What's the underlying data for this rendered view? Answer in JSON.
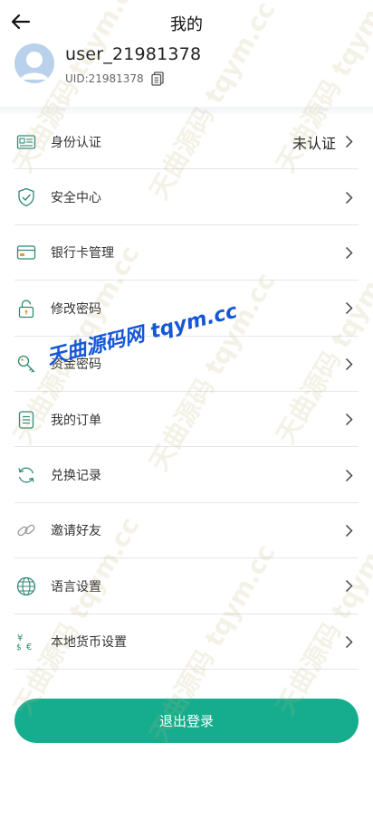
{
  "header": {
    "title": "我的"
  },
  "profile": {
    "username": "user_21981378",
    "uid": "UID:21981378"
  },
  "menu": [
    {
      "key": "identity",
      "label": "身份认证",
      "icon": "id-card-icon",
      "status": "未认证"
    },
    {
      "key": "security",
      "label": "安全中心",
      "icon": "shield-check-icon",
      "status": ""
    },
    {
      "key": "bank",
      "label": "银行卡管理",
      "icon": "bank-card-icon",
      "status": ""
    },
    {
      "key": "password",
      "label": "修改密码",
      "icon": "unlock-icon",
      "status": ""
    },
    {
      "key": "fund-password",
      "label": "资金密码",
      "icon": "key-icon",
      "status": ""
    },
    {
      "key": "orders",
      "label": "我的订单",
      "icon": "order-list-icon",
      "status": ""
    },
    {
      "key": "redeem",
      "label": "兑换记录",
      "icon": "refresh-icon",
      "status": ""
    },
    {
      "key": "invite",
      "label": "邀请好友",
      "icon": "link-icon",
      "status": ""
    },
    {
      "key": "language",
      "label": "语言设置",
      "icon": "globe-icon",
      "status": ""
    },
    {
      "key": "currency",
      "label": "本地货币设置",
      "icon": "currency-icon",
      "status": ""
    }
  ],
  "logout": {
    "label": "退出登录"
  },
  "watermark": {
    "text": "天曲源码 tqym.cc",
    "overlay": "天曲源码网 tqym.cc"
  },
  "colors": {
    "accent": "#16ad8e",
    "icon": "#2f8a74",
    "overlay": "#1557d6"
  }
}
